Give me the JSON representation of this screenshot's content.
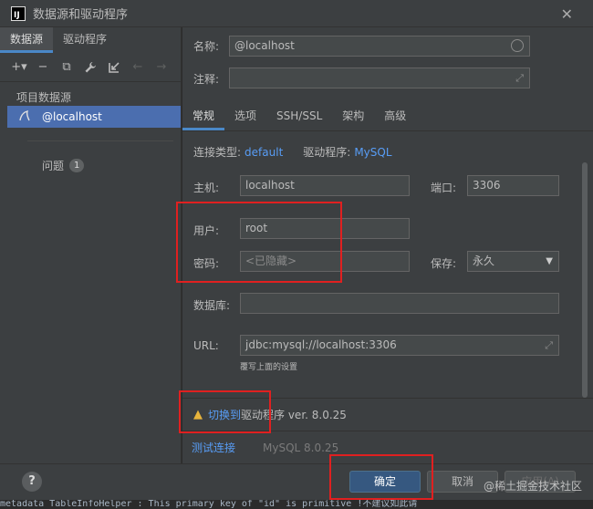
{
  "window": {
    "title": "数据源和驱动程序",
    "app_logo": "IJ",
    "close": "✕"
  },
  "left": {
    "tabs": [
      {
        "label": "数据源"
      },
      {
        "label": "驱动程序"
      }
    ],
    "toolbar": [
      {
        "icon": "add-icon",
        "glyph": "+▾"
      },
      {
        "icon": "remove-icon",
        "glyph": "−"
      },
      {
        "icon": "duplicate-icon",
        "glyph": "⧉"
      },
      {
        "icon": "wrench-icon",
        "glyph": "🔧"
      },
      {
        "icon": "import-icon",
        "glyph": "⇲"
      },
      {
        "icon": "back-icon",
        "glyph": "←"
      },
      {
        "icon": "forward-icon",
        "glyph": "→"
      }
    ],
    "section_title": "项目数据源",
    "datasource": "@localhost",
    "issues_label": "问题",
    "issues_count": "1"
  },
  "right": {
    "name_label": "名称:",
    "name_value": "@localhost",
    "comment_label": "注释:",
    "tabs": [
      {
        "label": "常规"
      },
      {
        "label": "选项"
      },
      {
        "label": "SSH/SSL"
      },
      {
        "label": "架构"
      },
      {
        "label": "高级"
      }
    ],
    "conn_type_label": "连接类型:",
    "conn_type_value": "default",
    "driver_label": "驱动程序:",
    "driver_value": "MySQL",
    "host_label": "主机:",
    "host_value": "localhost",
    "port_label": "端口:",
    "port_value": "3306",
    "user_label": "用户:",
    "user_value": "root",
    "password_label": "密码:",
    "password_value": "<已隐藏>",
    "save_label": "保存:",
    "save_value": "永久",
    "database_label": "数据库:",
    "url_label": "URL:",
    "url_value": "jdbc:mysql://localhost:3306",
    "url_hint": "覆写上面的设置",
    "warning_link": "切换到",
    "warning_text": "驱动程序 ver. 8.0.25",
    "test_connection": "测试连接",
    "driver_version": "MySQL 8.0.25"
  },
  "footer": {
    "help": "?",
    "ok": "确定",
    "cancel": "取消",
    "apply": "应用(A)"
  },
  "editor_line": "metadata TableInfoHelper     : This primary key of \"id\" is primitive !不建议如此请",
  "watermark": "@稀土掘金技术社区",
  "colors": {
    "accent": "#4a88c7",
    "selection": "#4b6eaf",
    "link": "#589df6",
    "annotation": "#e02020",
    "warning": "#e8b43c"
  }
}
